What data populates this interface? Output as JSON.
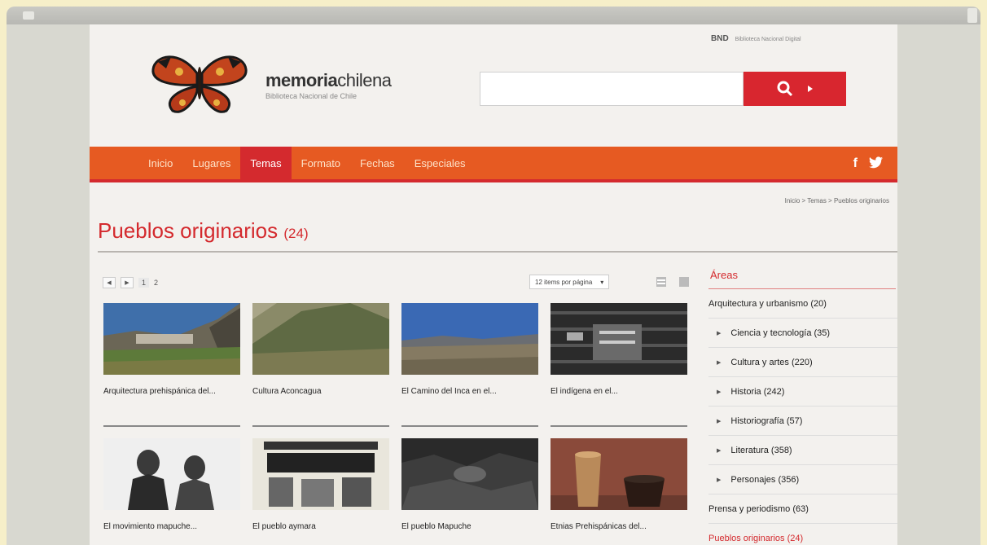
{
  "header": {
    "bnd_label": "BND",
    "bnd_sub": "Biblioteca Nacional Digital",
    "brand_bold": "memoria",
    "brand_rest": "chilena",
    "brand_sub": "Biblioteca Nacional de Chile"
  },
  "search": {
    "value": "",
    "placeholder": ""
  },
  "nav": {
    "items": [
      "Inicio",
      "Lugares",
      "Temas",
      "Formato",
      "Fechas",
      "Especiales"
    ],
    "active": "Temas",
    "facebook": "f",
    "twitter": "twitter-icon"
  },
  "breadcrumb": "Inicio > Temas > Pueblos originarios",
  "title": {
    "text": "Pueblos originarios",
    "count": "(24)"
  },
  "pager": {
    "page1": "1",
    "page2": "2"
  },
  "perpage": {
    "label": "12 items por página"
  },
  "cards": [
    {
      "label": "Arquitectura prehispánica del..."
    },
    {
      "label": "Cultura Aconcagua"
    },
    {
      "label": "El Camino del Inca en el..."
    },
    {
      "label": "El indígena en el..."
    },
    {
      "label": "El movimiento mapuche..."
    },
    {
      "label": "El pueblo aymara"
    },
    {
      "label": "El pueblo Mapuche"
    },
    {
      "label": "Etnias Prehispánicas del..."
    }
  ],
  "sidebar": {
    "title": "Áreas",
    "items": [
      {
        "label": "Arquitectura y urbanismo (20)",
        "sub": false
      },
      {
        "label": "Ciencia y tecnología (35)",
        "sub": true
      },
      {
        "label": "Cultura y artes (220)",
        "sub": true
      },
      {
        "label": "Historia (242)",
        "sub": true
      },
      {
        "label": "Historiografía (57)",
        "sub": true
      },
      {
        "label": "Literatura (358)",
        "sub": true
      },
      {
        "label": "Personajes (356)",
        "sub": true
      },
      {
        "label": "Prensa y periodismo (63)",
        "sub": false
      },
      {
        "label": "Pueblos originarios (24)",
        "sub": false,
        "selected": true
      }
    ]
  },
  "colors": {
    "accent": "#d42a2e",
    "nav": "#e65a22"
  }
}
